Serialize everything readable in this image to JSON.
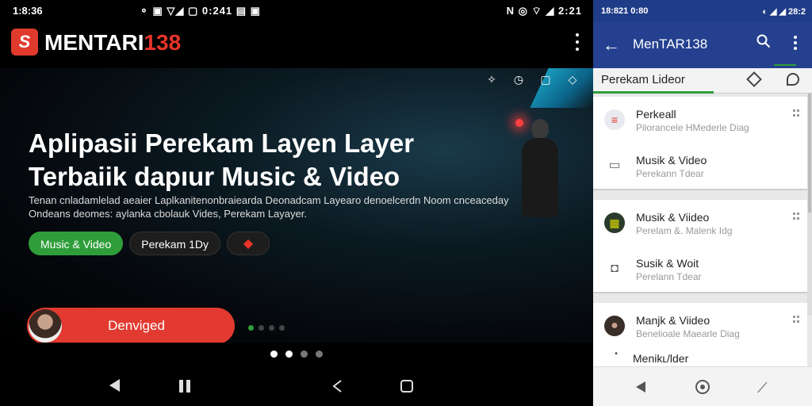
{
  "left": {
    "status": {
      "time": "1:8:36",
      "middle": "⚬ ▣ ▽◢ ▢ 0:241  ▤ ▣",
      "right": "N ◎ ⌔ ◢ 2:21"
    },
    "brand": {
      "logo_letter": "S",
      "name_white": "MENTARI",
      "name_red": "138"
    },
    "hero": {
      "title": "Aplipasii Perekam Layen Layer Terbaiik dapıur Music & Video",
      "subtitle": "Tenan cnladamlelad aeaier Laplkanitenonbraiearda Deonadcam Layearo denoelcerdn Noom cnceaceday Ondeans deomes: aylanka cbolauk Vides, Perekam Layayer.",
      "chips": [
        {
          "label": "Music & Video"
        },
        {
          "label": "Perekam 1Dy"
        },
        {
          "label": "◆"
        }
      ],
      "cta_label": "Denviged"
    }
  },
  "right": {
    "status": {
      "left": "18:821 0:80",
      "right": "◐ ◢ ◢ 28:2"
    },
    "appbar": {
      "back": "←",
      "title": "MenTAR138"
    },
    "tab": {
      "label": "Perekam Lideor"
    },
    "groups": [
      {
        "items": [
          {
            "title": "Perkeall",
            "subtitle": "Pilorancele HMederle Diag",
            "icon_color": "#e8eaf0",
            "icon": "≡",
            "icon_fg": "#e8342a"
          },
          {
            "title": "Musik & Video",
            "subtitle": "Perekann Tdear",
            "icon_color": "#ffffff",
            "icon": "▭",
            "icon_fg": "#666"
          }
        ]
      },
      {
        "items": [
          {
            "title": "Musik & Viideo",
            "subtitle": "Perelam &. Malenk Idg",
            "icon_color": "#2b3b2b",
            "icon": "▦",
            "icon_fg": "#e0e000"
          },
          {
            "title": "Susik & Woit",
            "subtitle": "Perelann Tdear",
            "icon_color": "#ffffff",
            "icon": "◘",
            "icon_fg": "#666"
          }
        ]
      },
      {
        "items": [
          {
            "title": "Manjk & Viideo",
            "subtitle": "Benelioale Maearle Diag",
            "icon_color": "#3a2e28",
            "icon": "●",
            "icon_fg": "#c9a28a"
          },
          {
            "title": "Menikʟ/lder",
            "subtitle": "",
            "icon_color": "#ffffff",
            "icon": "•",
            "icon_fg": "#333"
          }
        ]
      }
    ]
  }
}
